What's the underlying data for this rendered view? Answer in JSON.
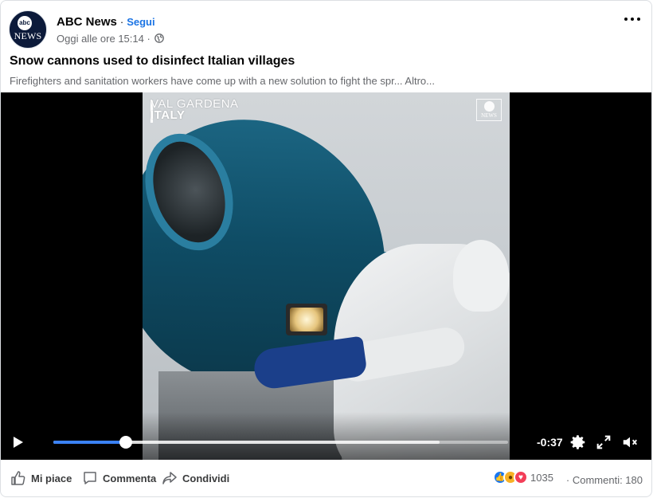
{
  "post": {
    "page_name": "ABC News",
    "separator": "·",
    "follow_label": "Segui",
    "timestamp": "Oggi alle ore 15:14 ·",
    "avatar_top": "abc",
    "avatar_bottom": "NEWS",
    "title": "Snow cannons used to disinfect Italian villages",
    "subtitle": "Firefighters and sanitation workers have come up with a new solution to fight the spr... Altro..."
  },
  "video": {
    "overlay_line1": "VAL GARDENA",
    "overlay_line2": "ITALY",
    "watermark": "NEWS",
    "time_remaining": "-0:37",
    "progress_played": 0.16,
    "progress_buffered": 0.85
  },
  "actions": {
    "like_label": "Mi piace",
    "comment_label": "Commenta",
    "share_label": "Condividi"
  },
  "stats": {
    "reactions_count": "1035",
    "comments_text": "· Commenti: 180",
    "reaction_icons": [
      "like-icon",
      "wow-icon",
      "love-icon"
    ]
  },
  "colors": {
    "accent": "#1b74e4",
    "progress": "#3b82f6",
    "like": "#1877f2",
    "love": "#f33e58",
    "wow": "#f7b125"
  }
}
